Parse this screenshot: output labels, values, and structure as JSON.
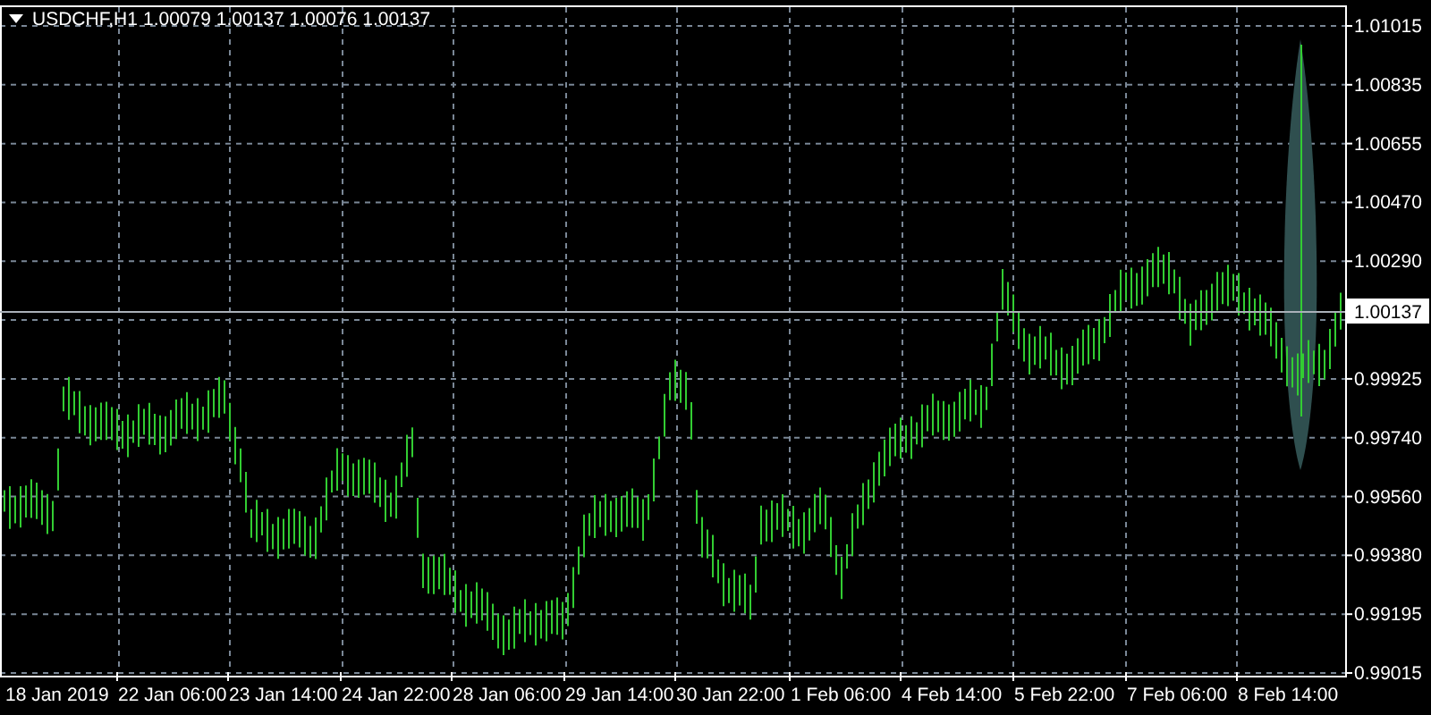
{
  "chart_header": {
    "symbol": "USDCHF,H1",
    "ohlc": "1.00079 1.00137 1.00076 1.00137"
  },
  "price_axis_labels": [
    "1.01015",
    "1.00835",
    "1.00655",
    "1.00470",
    "1.00290",
    "0.99925",
    "0.99740",
    "0.99560",
    "0.99380",
    "0.99195",
    "0.99015"
  ],
  "current_price": "1.00137",
  "time_axis_labels": [
    "18 Jan 2019",
    "22 Jan 06:00",
    "23 Jan 14:00",
    "24 Jan 22:00",
    "28 Jan 06:00",
    "29 Jan 14:00",
    "30 Jan 22:00",
    "1 Feb 06:00",
    "4 Feb 14:00",
    "5 Feb 22:00",
    "7 Feb 06:00",
    "8 Feb 14:00"
  ]
}
